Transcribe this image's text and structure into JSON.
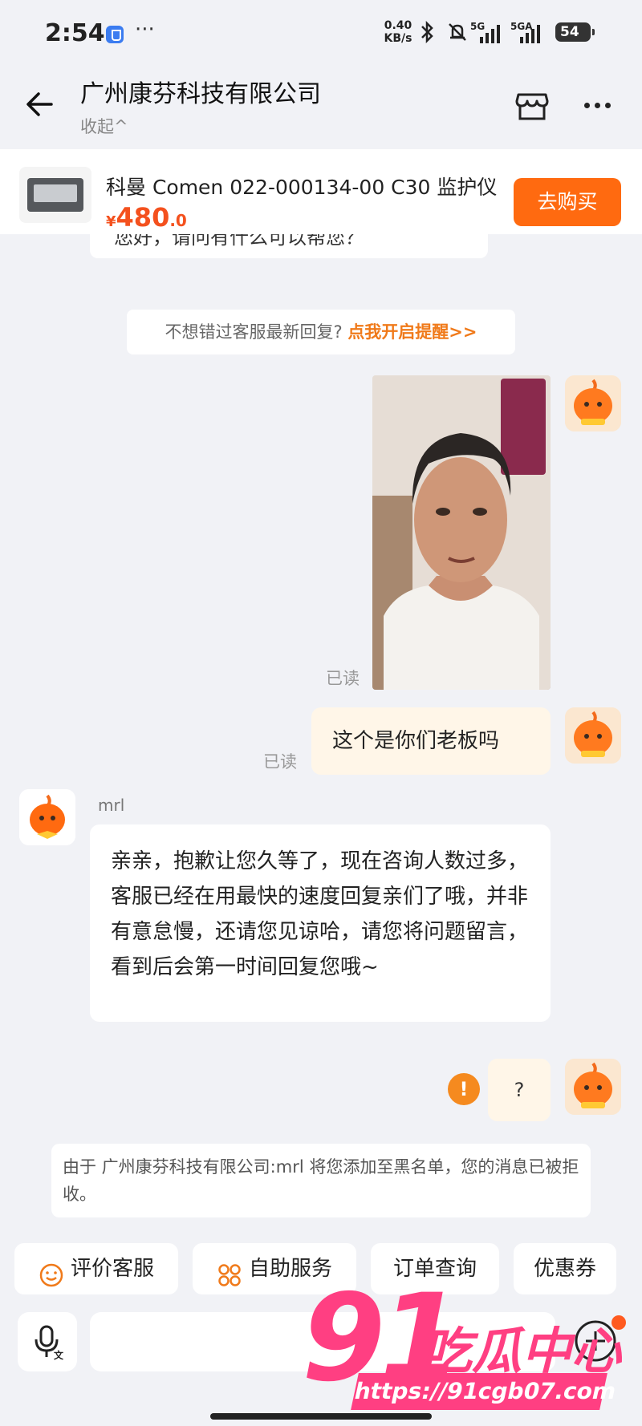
{
  "status_bar": {
    "time": "2:54",
    "dots": "···",
    "net_speed_value": "0.40",
    "net_speed_unit": "KB/s",
    "signal1_label": "5G",
    "signal2_label": "5GA",
    "battery": "54"
  },
  "header": {
    "title": "广州康芬科技有限公司",
    "collapse_label": "收起^"
  },
  "product": {
    "title": "科曼 Comen 022-000134-00 C30 监护仪",
    "price_currency": "¥",
    "price_int": "480",
    "price_dec": ".0",
    "buy_label": "去购买"
  },
  "chat": {
    "prev_partial_text": "您好，请问有什么可以帮您？",
    "reminder_text": "不想错过客服最新回复?",
    "reminder_link": "点我开启提醒>>",
    "read_label_1": "已读",
    "my_message": "这个是你们老板吗",
    "read_label_2": "已读",
    "agent_name": "mrl",
    "agent_message": "亲亲，抱歉让您久等了，现在咨询人数过多，客服已经在用最快的速度回复亲们了哦，并非有意怠慢，还请您见谅哈，请您将问题留言，看到后会第一时间回复您哦~",
    "warn_symbol": "!",
    "question_message": "?",
    "system_message": "由于 广州康芬科技有限公司:mrl 将您添加至黑名单，您的消息已被拒收。"
  },
  "quick_chips": [
    {
      "label": "评价客服",
      "icon": "smile-icon"
    },
    {
      "label": "自助服务",
      "icon": "grid-icon"
    },
    {
      "label": "订单查询",
      "icon": ""
    },
    {
      "label": "优惠券",
      "icon": ""
    }
  ],
  "watermark": {
    "number": "91",
    "name": "吃瓜中心",
    "url": "https://91cgb07.com"
  },
  "colors": {
    "accent": "#ff6a10",
    "price": "#f4511e",
    "bg": "#f1f2f6",
    "my_bubble": "#fff6e8",
    "watermark": "#ff3f82"
  }
}
